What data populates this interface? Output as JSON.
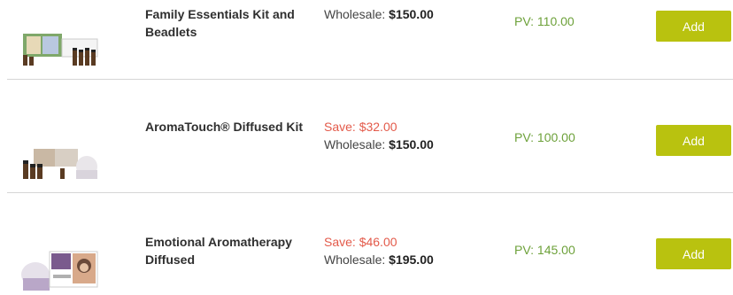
{
  "products": [
    {
      "name": "Family Essentials Kit and Beadlets",
      "save": "",
      "wholesale_label": "Wholesale:",
      "wholesale_value": "$150.00",
      "pv": "PV: 110.00",
      "add_label": "Add",
      "image_icon": "product-kit-image"
    },
    {
      "name": "AromaTouch® Diffused Kit",
      "save": "Save: $32.00",
      "wholesale_label": "Wholesale:",
      "wholesale_value": "$150.00",
      "pv": "PV: 100.00",
      "add_label": "Add",
      "image_icon": "product-kit-image"
    },
    {
      "name": "Emotional Aromatherapy Diffused",
      "save": "Save: $46.00",
      "wholesale_label": "Wholesale:",
      "wholesale_value": "$195.00",
      "pv": "PV: 145.00",
      "add_label": "Add",
      "image_icon": "product-kit-image"
    }
  ],
  "colors": {
    "add_button": "#b9c20f",
    "pv_text": "#6da13a",
    "save_text": "#e35a4a",
    "divider": "#d6d6d6"
  }
}
